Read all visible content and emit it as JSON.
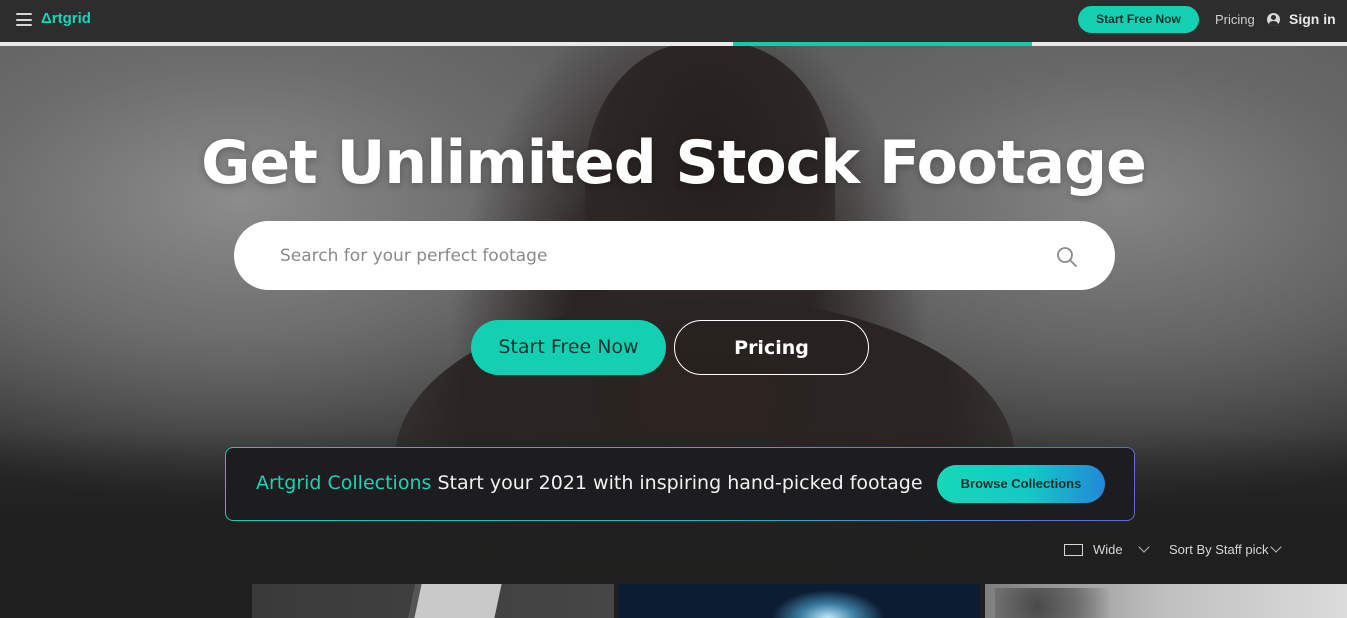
{
  "nav": {
    "logo": "Δrtgrid",
    "start_free": "Start Free Now",
    "pricing": "Pricing",
    "sign_in": "Sign in"
  },
  "hero": {
    "headline": "Get Unlimited Stock Footage",
    "search_placeholder": "Search for your perfect footage",
    "start_free": "Start Free Now",
    "pricing": "Pricing"
  },
  "collections": {
    "title": "Artgrid Collections",
    "subtitle": "Start your 2021 with inspiring hand-picked footage",
    "button": "Browse Collections"
  },
  "filters": {
    "view": "Wide",
    "sort": "Sort By Staff pick"
  },
  "colors": {
    "accent": "#14d0b2",
    "topbar": "#2d2d2d"
  }
}
